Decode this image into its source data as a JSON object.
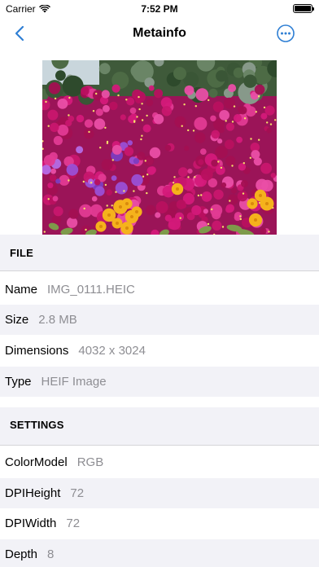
{
  "status": {
    "carrier": "Carrier",
    "time": "7:52 PM"
  },
  "nav": {
    "title": "Metainfo",
    "back_icon": "chevron-left-icon",
    "more_icon": "ellipsis-circle-icon"
  },
  "colors": {
    "accent": "#2f7fd4",
    "section_bg": "#f2f2f7",
    "value_text": "#8e8e93",
    "flower_magenta": "#c8166e",
    "flower_yellow": "#f5b21c"
  },
  "sections": [
    {
      "title": "FILE",
      "rows": [
        {
          "key": "Name",
          "value": "IMG_0111.HEIC"
        },
        {
          "key": "Size",
          "value": "2.8 MB"
        },
        {
          "key": "Dimensions",
          "value": "4032 x 3024"
        },
        {
          "key": "Type",
          "value": "HEIF Image"
        }
      ]
    },
    {
      "title": "SETTINGS",
      "rows": [
        {
          "key": "ColorModel",
          "value": "RGB"
        },
        {
          "key": "DPIHeight",
          "value": "72"
        },
        {
          "key": "DPIWidth",
          "value": "72"
        },
        {
          "key": "Depth",
          "value": "8"
        }
      ]
    }
  ]
}
